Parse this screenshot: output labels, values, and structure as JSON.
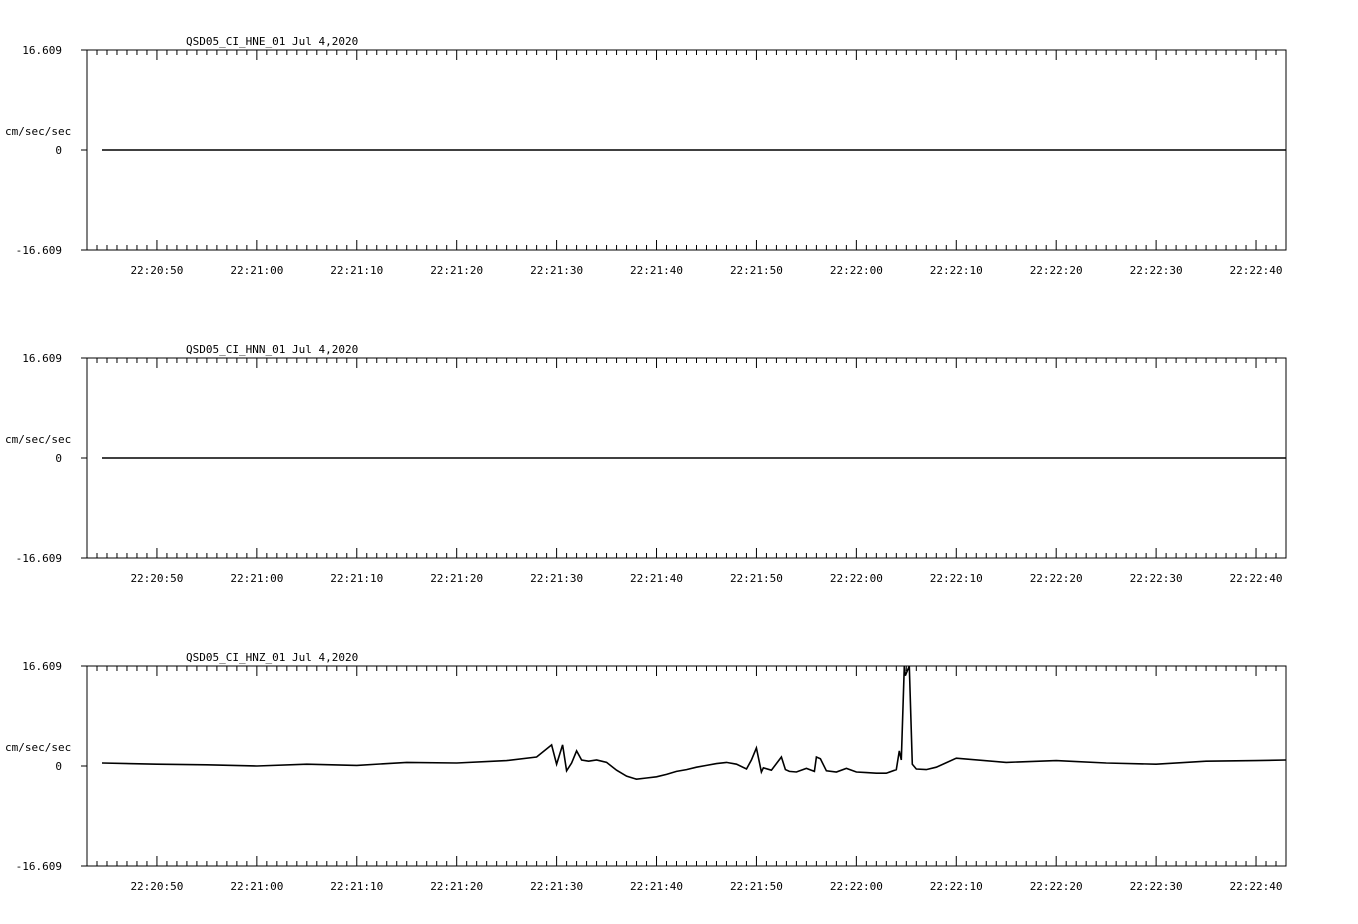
{
  "chart_data": [
    {
      "type": "line",
      "title": "QSD05_CI_HNE_01  Jul 4,2020",
      "ylabel": "cm/sec/sec",
      "ylim": [
        -16.609,
        16.609
      ],
      "y_tick_labels": [
        "16.609",
        "0",
        "-16.609"
      ],
      "x_tick_labels": [
        "22:20:50",
        "22:21:00",
        "22:21:10",
        "22:21:20",
        "22:21:30",
        "22:21:40",
        "22:21:50",
        "22:22:00",
        "22:22:10",
        "22:22:20",
        "22:22:30",
        "22:22:40"
      ],
      "x_range_seconds": [
        43.0,
        163.0
      ],
      "series": [
        {
          "x": [
            44.5,
            163.0
          ],
          "values": [
            0,
            0
          ]
        }
      ]
    },
    {
      "type": "line",
      "title": "QSD05_CI_HNN_01  Jul 4,2020",
      "ylabel": "cm/sec/sec",
      "ylim": [
        -16.609,
        16.609
      ],
      "y_tick_labels": [
        "16.609",
        "0",
        "-16.609"
      ],
      "x_tick_labels": [
        "22:20:50",
        "22:21:00",
        "22:21:10",
        "22:21:20",
        "22:21:30",
        "22:21:40",
        "22:21:50",
        "22:22:00",
        "22:22:10",
        "22:22:20",
        "22:22:30",
        "22:22:40"
      ],
      "x_range_seconds": [
        43.0,
        163.0
      ],
      "series": [
        {
          "x": [
            44.5,
            163.0
          ],
          "values": [
            0,
            0
          ]
        }
      ]
    },
    {
      "type": "line",
      "title": "QSD05_CI_HNZ_01  Jul 4,2020",
      "ylabel": "cm/sec/sec",
      "ylim": [
        -16.609,
        16.609
      ],
      "y_tick_labels": [
        "16.609",
        "0",
        "-16.609"
      ],
      "x_tick_labels": [
        "22:20:50",
        "22:21:00",
        "22:21:10",
        "22:21:20",
        "22:21:30",
        "22:21:40",
        "22:21:50",
        "22:22:00",
        "22:22:10",
        "22:22:20",
        "22:22:30",
        "22:22:40"
      ],
      "x_range_seconds": [
        43.0,
        163.0
      ],
      "series": [
        {
          "x": [
            44.5,
            50,
            55,
            60,
            65,
            70,
            75,
            80,
            85,
            88,
            89.5,
            90,
            90.6,
            91,
            91.5,
            92,
            92.5,
            93.2,
            94,
            95,
            96,
            97,
            98,
            99,
            100,
            101,
            102,
            103,
            104,
            105,
            106,
            107,
            108,
            109,
            109.5,
            110.0,
            110.5,
            110.7,
            111.5,
            112.5,
            112.9,
            113.3,
            114,
            115,
            115.8,
            116.0,
            116.4,
            117,
            118,
            119,
            120,
            121,
            122,
            123,
            124,
            124.3,
            124.5,
            124.8,
            124.9,
            125.3,
            125.6,
            126,
            127,
            128,
            130,
            135,
            140,
            145,
            150,
            155,
            160,
            163
          ],
          "values": [
            0.5,
            0.3,
            0.2,
            0.0,
            0.3,
            0.1,
            0.6,
            0.5,
            0.9,
            1.5,
            3.5,
            0.3,
            3.5,
            -0.8,
            0.5,
            2.5,
            1.0,
            0.8,
            1.0,
            0.6,
            -0.7,
            -1.7,
            -2.2,
            -2.0,
            -1.8,
            -1.4,
            -0.9,
            -0.6,
            -0.2,
            0.1,
            0.4,
            0.6,
            0.3,
            -0.5,
            1.0,
            3.0,
            -1.0,
            -0.3,
            -0.7,
            1.5,
            -0.6,
            -0.9,
            -1.0,
            -0.4,
            -0.9,
            1.5,
            1.2,
            -0.8,
            -1.0,
            -0.4,
            -1.0,
            -1.1,
            -1.2,
            -1.2,
            -0.6,
            2.5,
            1.0,
            16.6,
            15.0,
            16.6,
            0.3,
            -0.5,
            -0.6,
            -0.2,
            1.3,
            0.6,
            0.9,
            0.5,
            0.3,
            0.8,
            0.9,
            1.0
          ]
        }
      ]
    }
  ]
}
